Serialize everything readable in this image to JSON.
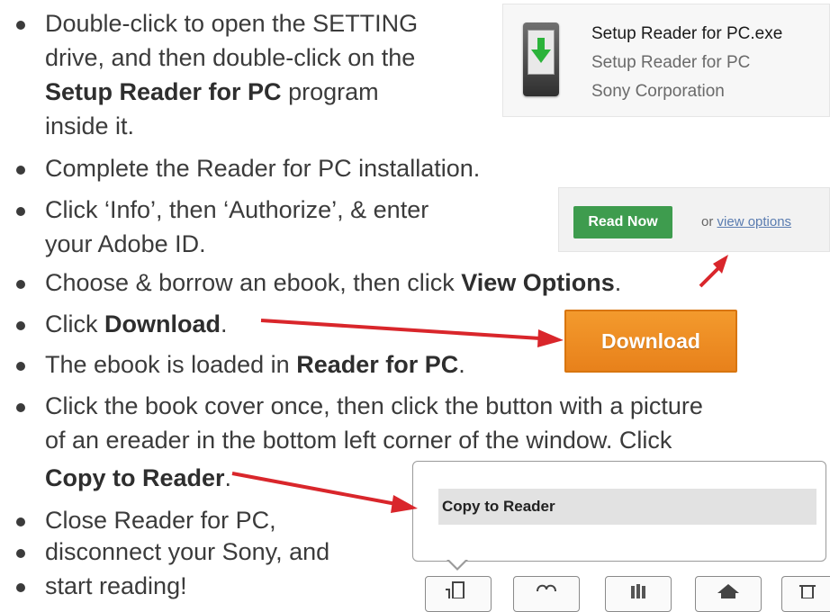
{
  "steps": {
    "s1_pre": "Double-click to open the SETTING",
    "s1_line2": "drive, and then double-click on the",
    "s1_bold": "Setup Reader for PC",
    "s1_post": " program",
    "s1_line4": "inside it.",
    "s2": "Complete the Reader for PC installation.",
    "s3_line1": "Click ‘Info’, then ‘Authorize’, & enter",
    "s3_line2": "your Adobe ID.",
    "s4_pre": "Choose & borrow an ebook, then click ",
    "s4_bold": "View Options",
    "s4_post": ".",
    "s5_pre": "Click ",
    "s5_bold": "Download",
    "s5_post": ".",
    "s6_pre": "The ebook is loaded in ",
    "s6_bold": "Reader for PC",
    "s6_post": ".",
    "s7_line1": "Click the book cover once, then click the button with a picture",
    "s7_line2": "of an ereader in the bottom left corner of the window. Click",
    "s7_bold": "Copy to Reader",
    "s7_post": ".",
    "s8": "Close Reader for PC,",
    "s9": "disconnect your Sony, and",
    "s10": "start reading!"
  },
  "file_panel": {
    "name": "Setup Reader for PC.exe",
    "description": "Setup Reader for PC",
    "company": "Sony Corporation",
    "icon": "ereader-download-icon"
  },
  "readnow_panel": {
    "button_label": "Read Now",
    "or_text": "or ",
    "link_label": "view options"
  },
  "download_button": {
    "label": "Download"
  },
  "copy_popup": {
    "menu_item": "Copy to Reader"
  },
  "colors": {
    "read_now_green": "#3e9c4e",
    "download_orange": "#f0901f",
    "arrow_red": "#d9262b",
    "text": "#3b3b3b"
  }
}
